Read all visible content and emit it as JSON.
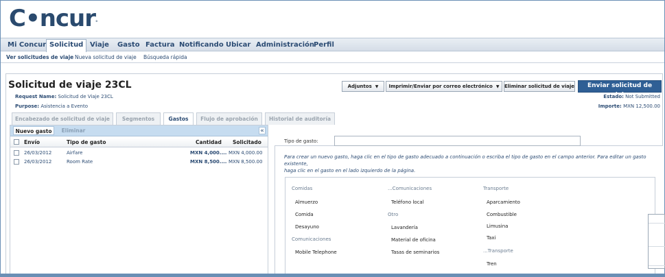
{
  "logo": {
    "text_c": "C",
    "text_rest": "ncur",
    "mark": "°"
  },
  "nav": {
    "items": [
      {
        "label": "Mi Concur"
      },
      {
        "label": "Solicitud"
      },
      {
        "label": "Viaje"
      },
      {
        "label": "Gasto"
      },
      {
        "label": "Factura"
      },
      {
        "label": "Notificando"
      },
      {
        "label": "Ubicar"
      },
      {
        "label": "Administración"
      },
      {
        "label": "Perfil"
      }
    ]
  },
  "subnav": {
    "items": [
      {
        "label": "Ver solicitudes de viaje"
      },
      {
        "label": "Nueva solicitud de viaje"
      },
      {
        "label": "Búsqueda rápida"
      }
    ]
  },
  "request": {
    "title": "Solicitud de viaje 23CL",
    "name_label": "Request Name:",
    "name_value": "Solicitud de Viaje 23CL",
    "purpose_label": "Purpose:",
    "purpose_value": "Asistencia a Evento",
    "estado_label": "Estado:",
    "estado_value": "Not Submitted",
    "importe_label": "Importe:",
    "importe_value": "MXN 12,500.00"
  },
  "actions": {
    "adjuntos": "Adjuntos",
    "imprimir": "Imprimir/Enviar por correo electrónico",
    "eliminar": "Eliminar solicitud de viaje",
    "enviar": "Enviar solicitud de viaje"
  },
  "tabs": [
    {
      "label": "Encabezado de solicitud de viaje"
    },
    {
      "label": "Segmentos"
    },
    {
      "label": "Gastos"
    },
    {
      "label": "Flujo de aprobación"
    },
    {
      "label": "Historial de auditoría"
    }
  ],
  "left": {
    "nuevo": "Nuevo gasto",
    "eliminar": "Eliminar",
    "collapse": "«",
    "columns": [
      "Envío",
      "Tipo de gasto",
      "Cantidad",
      "Solicitado"
    ],
    "rows": [
      {
        "fecha": "26/03/2012",
        "tipo": "Airfare",
        "cantidad": "MXN 4,000....",
        "solicitado": "MXN 4,000.00"
      },
      {
        "fecha": "26/03/2012",
        "tipo": "Room Rate",
        "cantidad": "MXN 8,500....",
        "solicitado": "MXN 8,500.00"
      }
    ]
  },
  "right": {
    "tipo_label": "Tipo de gasto:",
    "tipo_value": "",
    "help_line1": "Para crear un nuevo gasto, haga clic en el tipo de gasto adecuado a continuación o escriba el tipo de gasto en el campo anterior. Para editar un gasto existente,",
    "help_line2": "haga clic en el gasto en el lado izquierdo de la página."
  },
  "categories": {
    "col1": {
      "h1": "Comidas",
      "items1": [
        "Almuerzo",
        "Comida",
        "Desayuno"
      ],
      "h2": "Comunicaciones",
      "items2": [
        "Mobile Telephone"
      ]
    },
    "col2": {
      "h1": "...Comunicaciones",
      "items1": [
        "Teléfono local"
      ],
      "h2": "Otro",
      "items2": [
        "Lavandería",
        "Material de oficina",
        "Tasas de seminarios"
      ]
    },
    "col3": {
      "h1": "Transporte",
      "items1": [
        "Aparcamiento",
        "Combustible",
        "Limusina",
        "Taxi"
      ],
      "h2": "...Transporte",
      "items2": [
        "Tren"
      ]
    }
  }
}
